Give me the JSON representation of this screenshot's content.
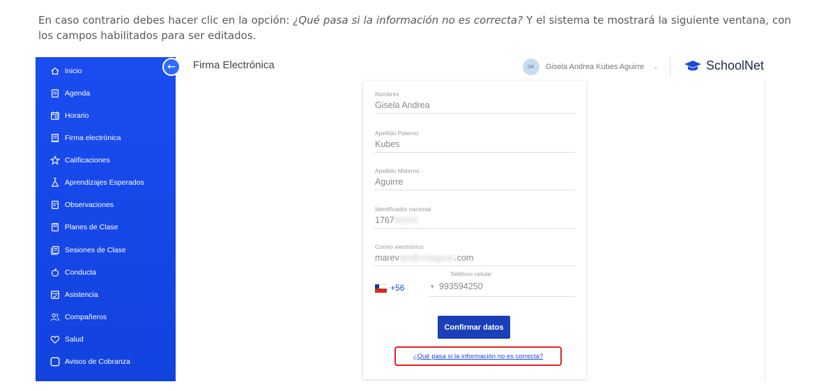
{
  "doc": {
    "text_before": "En caso contrario debes hacer clic en la opción: ",
    "text_italic": "¿Qué pasa si la información no es correcta?",
    "text_after": " Y el sistema te mostrará la siguiente ventana, con los campos habilitados para ser editados."
  },
  "sidebar": {
    "items": [
      {
        "label": "Inicio",
        "icon": "home-icon"
      },
      {
        "label": "Agenda",
        "icon": "agenda-icon"
      },
      {
        "label": "Horario",
        "icon": "calendar-icon"
      },
      {
        "label": "Firma electrónica",
        "icon": "signature-icon"
      },
      {
        "label": "Calificaciones",
        "icon": "star-icon"
      },
      {
        "label": "Aprendizajes Esperados",
        "icon": "flask-icon"
      },
      {
        "label": "Observaciones",
        "icon": "note-icon"
      },
      {
        "label": "Planes de Clase",
        "icon": "plan-icon"
      },
      {
        "label": "Sesiones de Clase",
        "icon": "sessions-icon"
      },
      {
        "label": "Conducta",
        "icon": "apple-icon"
      },
      {
        "label": "Asistencia",
        "icon": "attendance-icon"
      },
      {
        "label": "Compañeros",
        "icon": "people-icon"
      },
      {
        "label": "Salud",
        "icon": "heart-icon"
      },
      {
        "label": "Avisos de Cobranza",
        "icon": "checkbox-icon"
      }
    ]
  },
  "header": {
    "back_glyph": "←",
    "title": "Firma Electrónica",
    "avatar_initials": "GK",
    "user_name": "Gisela Andrea Kubes Aguirre",
    "brand": "SchoolNet"
  },
  "form": {
    "nombres": {
      "label": "Nombres",
      "value": "Gisela Andrea"
    },
    "apellido_paterno": {
      "label": "Apellido Paterno",
      "value": "Kubes"
    },
    "apellido_materno": {
      "label": "Apellido Materno",
      "value": "Aguirre"
    },
    "identificador": {
      "label": "Identificador nacional",
      "value_visible": "1767",
      "value_blurred": "56241"
    },
    "correo": {
      "label": "Correo electrónico",
      "value_start": "marev",
      "value_blurred": "alo@colegium",
      "value_end": ".com"
    },
    "telefono": {
      "label": "Teléfono celular",
      "country_code": "+56",
      "value": "993594250"
    },
    "confirm_button": "Confirmar datos",
    "help_link": "¿Qué pasa si la información no es correcta?"
  }
}
